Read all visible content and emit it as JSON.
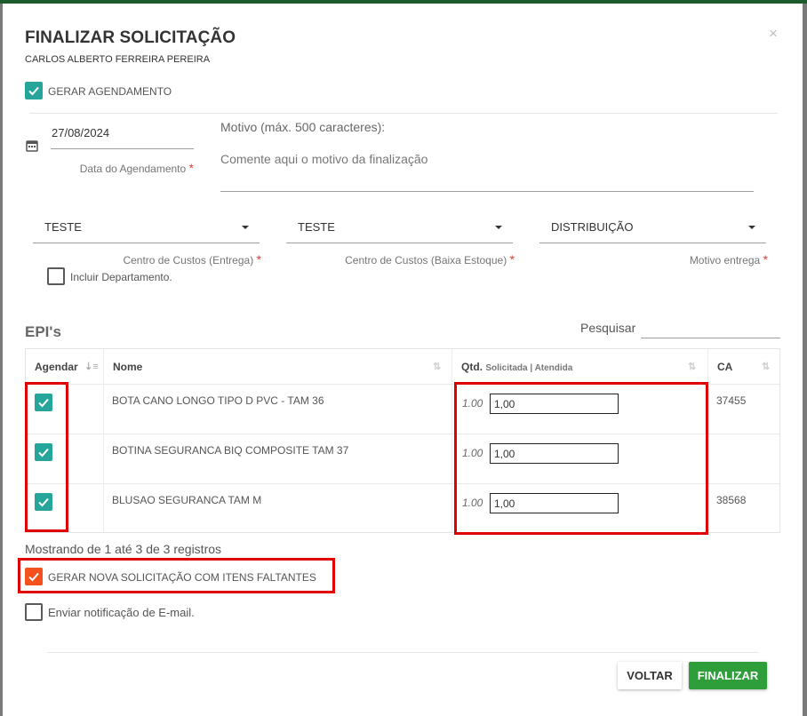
{
  "modal": {
    "title": "FINALIZAR SOLICITAÇÃO",
    "subtitle": "CARLOS ALBERTO FERREIRA PEREIRA",
    "close_symbol": "×"
  },
  "schedule": {
    "checkbox_label": "GERAR AGENDAMENTO",
    "checked": true,
    "date_value": "27/08/2024",
    "date_label": "Data do Agendamento",
    "required_mark": "*",
    "icon": "calendar-icon"
  },
  "reason": {
    "label": "Motivo (máx. 500 caracteres):",
    "placeholder": "Comente aqui o motivo da finalização"
  },
  "selects": [
    {
      "value": "TESTE",
      "label": "Centro de Custos (Entrega)",
      "required": "*"
    },
    {
      "value": "TESTE",
      "label": "Centro de Custos (Baixa Estoque)",
      "required": "*"
    },
    {
      "value": "DISTRIBUIÇÃO",
      "label": "Motivo entrega",
      "required": "*"
    }
  ],
  "include_department": {
    "label": "Incluir Departamento.",
    "checked": false
  },
  "epis": {
    "section_title": "EPI's",
    "search_label": "Pesquisar",
    "columns": {
      "schedule": "Agendar",
      "name": "Nome",
      "qty": "Qtd.",
      "qty_sub": "Solicitada | Atendida",
      "ca": "CA"
    },
    "rows": [
      {
        "checked": true,
        "name": "BOTA CANO LONGO TIPO D PVC - TAM 36",
        "requested": "1.00",
        "attended": "1,00",
        "ca": "37455"
      },
      {
        "checked": true,
        "name": "BOTINA SEGURANCA BIQ COMPOSITE TAM 37",
        "requested": "1.00",
        "attended": "1,00",
        "ca": ""
      },
      {
        "checked": true,
        "name": "BLUSAO SEGURANCA TAM M",
        "requested": "1.00",
        "attended": "1,00",
        "ca": "38568"
      }
    ],
    "footer": "Mostrando de 1 até 3 de 3 registros"
  },
  "new_request": {
    "label": "GERAR NOVA SOLICITAÇÃO COM ITENS FALTANTES",
    "checked": true
  },
  "email_notify": {
    "label": "Enviar notificação de E-mail.",
    "checked": false
  },
  "buttons": {
    "back": "VOLTAR",
    "finish": "FINALIZAR"
  },
  "colors": {
    "teal_check": "#26a69a",
    "orange_check": "#f4511e",
    "finish_button": "#2e9e3b",
    "highlight_box": "#e00000",
    "required": "#e53935"
  }
}
